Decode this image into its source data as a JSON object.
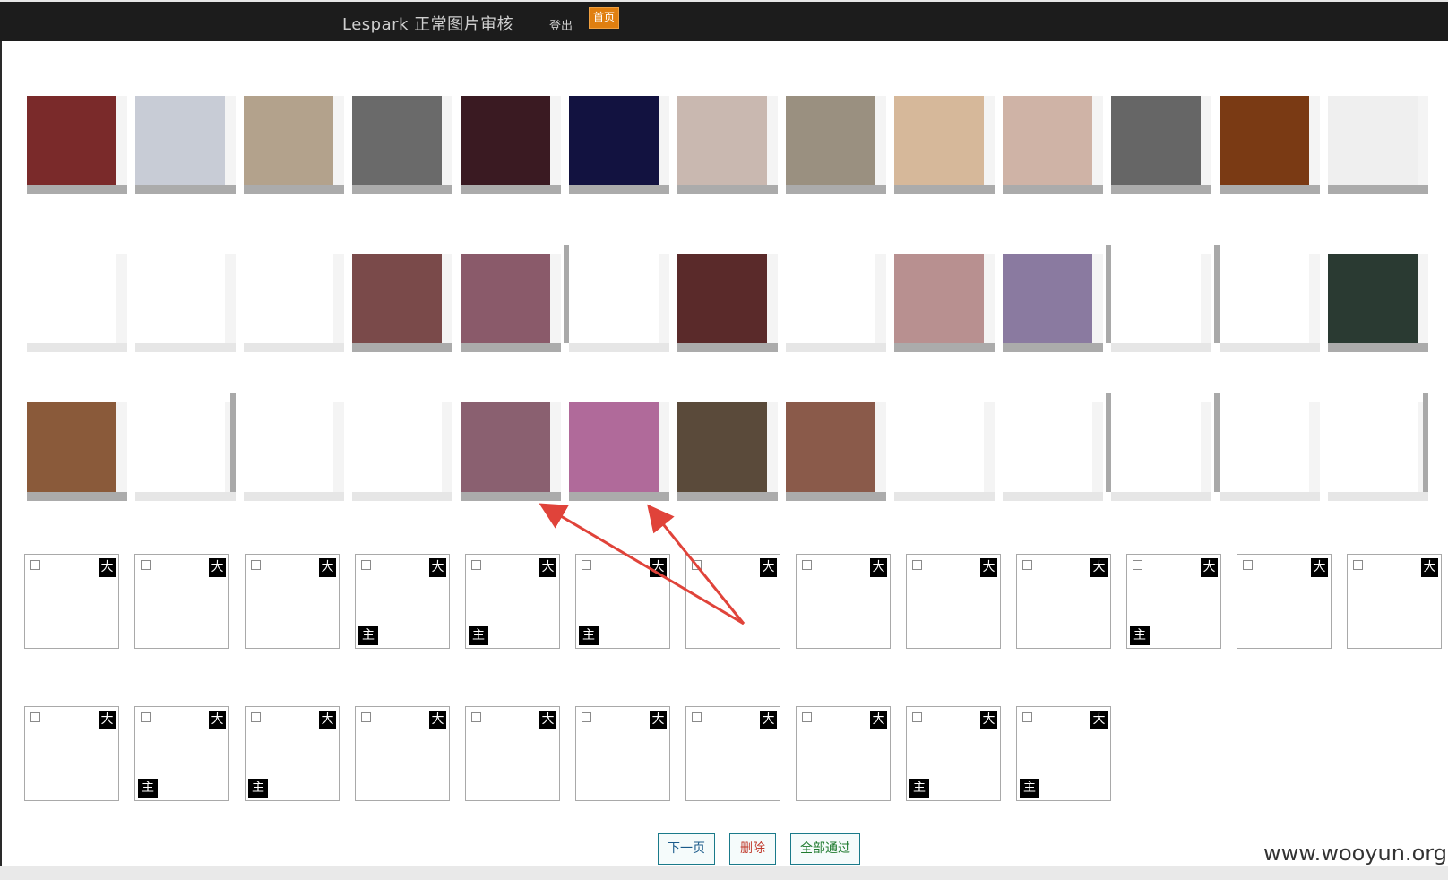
{
  "header": {
    "title": "Lespark 正常图片审核",
    "logout_label": "登出",
    "home_label": "首页",
    "accent_color": "#e07f10",
    "bar_color": "#1c1c1c"
  },
  "review_grid": {
    "big_label": "大",
    "main_label": "主",
    "rows": [
      [
        {
          "checked": false,
          "is_main": false
        },
        {
          "checked": false,
          "is_main": false
        },
        {
          "checked": false,
          "is_main": false
        },
        {
          "checked": false,
          "is_main": true
        },
        {
          "checked": false,
          "is_main": true
        },
        {
          "checked": false,
          "is_main": true
        },
        {
          "checked": false,
          "is_main": false
        },
        {
          "checked": false,
          "is_main": false
        },
        {
          "checked": false,
          "is_main": false
        },
        {
          "checked": false,
          "is_main": false
        },
        {
          "checked": false,
          "is_main": true
        },
        {
          "checked": false,
          "is_main": false
        },
        {
          "checked": false,
          "is_main": false
        }
      ],
      [
        {
          "checked": false,
          "is_main": false
        },
        {
          "checked": false,
          "is_main": true
        },
        {
          "checked": false,
          "is_main": true
        },
        {
          "checked": false,
          "is_main": false
        },
        {
          "checked": false,
          "is_main": false
        },
        {
          "checked": false,
          "is_main": false
        },
        {
          "checked": false,
          "is_main": false
        },
        {
          "checked": false,
          "is_main": false
        },
        {
          "checked": false,
          "is_main": true
        },
        {
          "checked": false,
          "is_main": true
        }
      ]
    ]
  },
  "thumbnails": {
    "rows": [
      [
        "#7a2a2a",
        "#c8ccd6",
        "#b3a28c",
        "#6a6a6a",
        "#3a1a22",
        "#121240",
        "#c9b8b0",
        "#9a9080",
        "#d6b89a",
        "#cfb3a6",
        "#666666",
        "#7a3a14",
        "#efefef"
      ],
      [
        "#ffffff",
        "#ffffff",
        "#ffffff",
        "#7a4a4a",
        "#8a5a6a",
        "#ffffff",
        "#5a2a2a",
        "#ffffff",
        "#b89090",
        "#8a7aa0",
        "#ffffff",
        "#ffffff",
        "#2a3a32"
      ],
      [
        "#8a5a3a",
        "#ffffff",
        "#ffffff",
        "#ffffff",
        "#8a6070",
        "#b06a9a",
        "#5a4a3a",
        "#8a5a4a",
        "#ffffff",
        "#ffffff",
        "#ffffff",
        "#ffffff",
        "#ffffff"
      ]
    ]
  },
  "actions": {
    "next_label": "下一页",
    "delete_label": "删除",
    "approve_all_label": "全部通过",
    "delete_color": "#c0392b",
    "approve_color": "#1e7a2e",
    "next_color": "#1a5a8a"
  },
  "watermark": "www.wooyun.org",
  "annotation": {
    "arrow_color": "#e0433a"
  }
}
